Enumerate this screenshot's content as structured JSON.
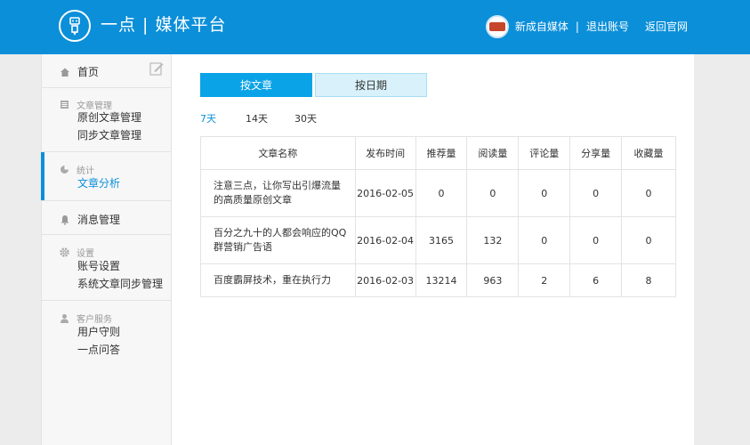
{
  "header": {
    "brand": "一点 | 媒体平台",
    "username": "新成自媒体",
    "separator": "|",
    "logout": "退出账号",
    "back": "返回官网"
  },
  "sidebar": {
    "home": "首页",
    "article_mgmt": {
      "title": "文章管理",
      "items": [
        "原创文章管理",
        "同步文章管理"
      ]
    },
    "stats": {
      "title": "统计",
      "items": [
        "文章分析"
      ]
    },
    "messages": "消息管理",
    "settings": {
      "title": "设置",
      "items": [
        "账号设置",
        "系统文章同步管理"
      ]
    },
    "service": {
      "title": "客户服务",
      "items": [
        "用户守则",
        "一点问答"
      ]
    }
  },
  "tabs": {
    "by_article": "按文章",
    "by_date": "按日期"
  },
  "ranges": [
    "7天",
    "14天",
    "30天"
  ],
  "table": {
    "headers": [
      "文章名称",
      "发布时间",
      "推荐量",
      "阅读量",
      "评论量",
      "分享量",
      "收藏量"
    ],
    "rows": [
      {
        "name": "注意三点，让你写出引爆流量的高质量原创文章",
        "date": "2016-02-05",
        "rec": "0",
        "read": "0",
        "comment": "0",
        "share": "0",
        "fav": "0"
      },
      {
        "name": "百分之九十的人都会响应的QQ群营销广告语",
        "date": "2016-02-04",
        "rec": "3165",
        "read": "132",
        "comment": "0",
        "share": "0",
        "fav": "0"
      },
      {
        "name": "百度霸屏技术，重在执行力",
        "date": "2016-02-03",
        "rec": "13214",
        "read": "963",
        "comment": "2",
        "share": "6",
        "fav": "8"
      }
    ]
  },
  "colors": {
    "brand_blue": "#0b8fd9",
    "tab_active": "#0aa3e8",
    "tab_inactive": "#d8f1fb"
  }
}
